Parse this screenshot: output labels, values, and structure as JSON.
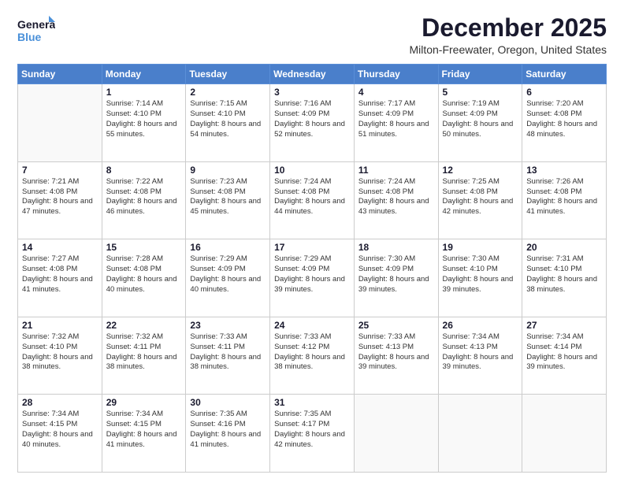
{
  "header": {
    "logo_general": "General",
    "logo_blue": "Blue",
    "month_title": "December 2025",
    "subtitle": "Milton-Freewater, Oregon, United States"
  },
  "days_of_week": [
    "Sunday",
    "Monday",
    "Tuesday",
    "Wednesday",
    "Thursday",
    "Friday",
    "Saturday"
  ],
  "weeks": [
    [
      {
        "num": "",
        "sunrise": "",
        "sunset": "",
        "daylight": ""
      },
      {
        "num": "1",
        "sunrise": "Sunrise: 7:14 AM",
        "sunset": "Sunset: 4:10 PM",
        "daylight": "Daylight: 8 hours and 55 minutes."
      },
      {
        "num": "2",
        "sunrise": "Sunrise: 7:15 AM",
        "sunset": "Sunset: 4:10 PM",
        "daylight": "Daylight: 8 hours and 54 minutes."
      },
      {
        "num": "3",
        "sunrise": "Sunrise: 7:16 AM",
        "sunset": "Sunset: 4:09 PM",
        "daylight": "Daylight: 8 hours and 52 minutes."
      },
      {
        "num": "4",
        "sunrise": "Sunrise: 7:17 AM",
        "sunset": "Sunset: 4:09 PM",
        "daylight": "Daylight: 8 hours and 51 minutes."
      },
      {
        "num": "5",
        "sunrise": "Sunrise: 7:19 AM",
        "sunset": "Sunset: 4:09 PM",
        "daylight": "Daylight: 8 hours and 50 minutes."
      },
      {
        "num": "6",
        "sunrise": "Sunrise: 7:20 AM",
        "sunset": "Sunset: 4:08 PM",
        "daylight": "Daylight: 8 hours and 48 minutes."
      }
    ],
    [
      {
        "num": "7",
        "sunrise": "Sunrise: 7:21 AM",
        "sunset": "Sunset: 4:08 PM",
        "daylight": "Daylight: 8 hours and 47 minutes."
      },
      {
        "num": "8",
        "sunrise": "Sunrise: 7:22 AM",
        "sunset": "Sunset: 4:08 PM",
        "daylight": "Daylight: 8 hours and 46 minutes."
      },
      {
        "num": "9",
        "sunrise": "Sunrise: 7:23 AM",
        "sunset": "Sunset: 4:08 PM",
        "daylight": "Daylight: 8 hours and 45 minutes."
      },
      {
        "num": "10",
        "sunrise": "Sunrise: 7:24 AM",
        "sunset": "Sunset: 4:08 PM",
        "daylight": "Daylight: 8 hours and 44 minutes."
      },
      {
        "num": "11",
        "sunrise": "Sunrise: 7:24 AM",
        "sunset": "Sunset: 4:08 PM",
        "daylight": "Daylight: 8 hours and 43 minutes."
      },
      {
        "num": "12",
        "sunrise": "Sunrise: 7:25 AM",
        "sunset": "Sunset: 4:08 PM",
        "daylight": "Daylight: 8 hours and 42 minutes."
      },
      {
        "num": "13",
        "sunrise": "Sunrise: 7:26 AM",
        "sunset": "Sunset: 4:08 PM",
        "daylight": "Daylight: 8 hours and 41 minutes."
      }
    ],
    [
      {
        "num": "14",
        "sunrise": "Sunrise: 7:27 AM",
        "sunset": "Sunset: 4:08 PM",
        "daylight": "Daylight: 8 hours and 41 minutes."
      },
      {
        "num": "15",
        "sunrise": "Sunrise: 7:28 AM",
        "sunset": "Sunset: 4:08 PM",
        "daylight": "Daylight: 8 hours and 40 minutes."
      },
      {
        "num": "16",
        "sunrise": "Sunrise: 7:29 AM",
        "sunset": "Sunset: 4:09 PM",
        "daylight": "Daylight: 8 hours and 40 minutes."
      },
      {
        "num": "17",
        "sunrise": "Sunrise: 7:29 AM",
        "sunset": "Sunset: 4:09 PM",
        "daylight": "Daylight: 8 hours and 39 minutes."
      },
      {
        "num": "18",
        "sunrise": "Sunrise: 7:30 AM",
        "sunset": "Sunset: 4:09 PM",
        "daylight": "Daylight: 8 hours and 39 minutes."
      },
      {
        "num": "19",
        "sunrise": "Sunrise: 7:30 AM",
        "sunset": "Sunset: 4:10 PM",
        "daylight": "Daylight: 8 hours and 39 minutes."
      },
      {
        "num": "20",
        "sunrise": "Sunrise: 7:31 AM",
        "sunset": "Sunset: 4:10 PM",
        "daylight": "Daylight: 8 hours and 38 minutes."
      }
    ],
    [
      {
        "num": "21",
        "sunrise": "Sunrise: 7:32 AM",
        "sunset": "Sunset: 4:10 PM",
        "daylight": "Daylight: 8 hours and 38 minutes."
      },
      {
        "num": "22",
        "sunrise": "Sunrise: 7:32 AM",
        "sunset": "Sunset: 4:11 PM",
        "daylight": "Daylight: 8 hours and 38 minutes."
      },
      {
        "num": "23",
        "sunrise": "Sunrise: 7:33 AM",
        "sunset": "Sunset: 4:11 PM",
        "daylight": "Daylight: 8 hours and 38 minutes."
      },
      {
        "num": "24",
        "sunrise": "Sunrise: 7:33 AM",
        "sunset": "Sunset: 4:12 PM",
        "daylight": "Daylight: 8 hours and 38 minutes."
      },
      {
        "num": "25",
        "sunrise": "Sunrise: 7:33 AM",
        "sunset": "Sunset: 4:13 PM",
        "daylight": "Daylight: 8 hours and 39 minutes."
      },
      {
        "num": "26",
        "sunrise": "Sunrise: 7:34 AM",
        "sunset": "Sunset: 4:13 PM",
        "daylight": "Daylight: 8 hours and 39 minutes."
      },
      {
        "num": "27",
        "sunrise": "Sunrise: 7:34 AM",
        "sunset": "Sunset: 4:14 PM",
        "daylight": "Daylight: 8 hours and 39 minutes."
      }
    ],
    [
      {
        "num": "28",
        "sunrise": "Sunrise: 7:34 AM",
        "sunset": "Sunset: 4:15 PM",
        "daylight": "Daylight: 8 hours and 40 minutes."
      },
      {
        "num": "29",
        "sunrise": "Sunrise: 7:34 AM",
        "sunset": "Sunset: 4:15 PM",
        "daylight": "Daylight: 8 hours and 41 minutes."
      },
      {
        "num": "30",
        "sunrise": "Sunrise: 7:35 AM",
        "sunset": "Sunset: 4:16 PM",
        "daylight": "Daylight: 8 hours and 41 minutes."
      },
      {
        "num": "31",
        "sunrise": "Sunrise: 7:35 AM",
        "sunset": "Sunset: 4:17 PM",
        "daylight": "Daylight: 8 hours and 42 minutes."
      },
      {
        "num": "",
        "sunrise": "",
        "sunset": "",
        "daylight": ""
      },
      {
        "num": "",
        "sunrise": "",
        "sunset": "",
        "daylight": ""
      },
      {
        "num": "",
        "sunrise": "",
        "sunset": "",
        "daylight": ""
      }
    ]
  ]
}
